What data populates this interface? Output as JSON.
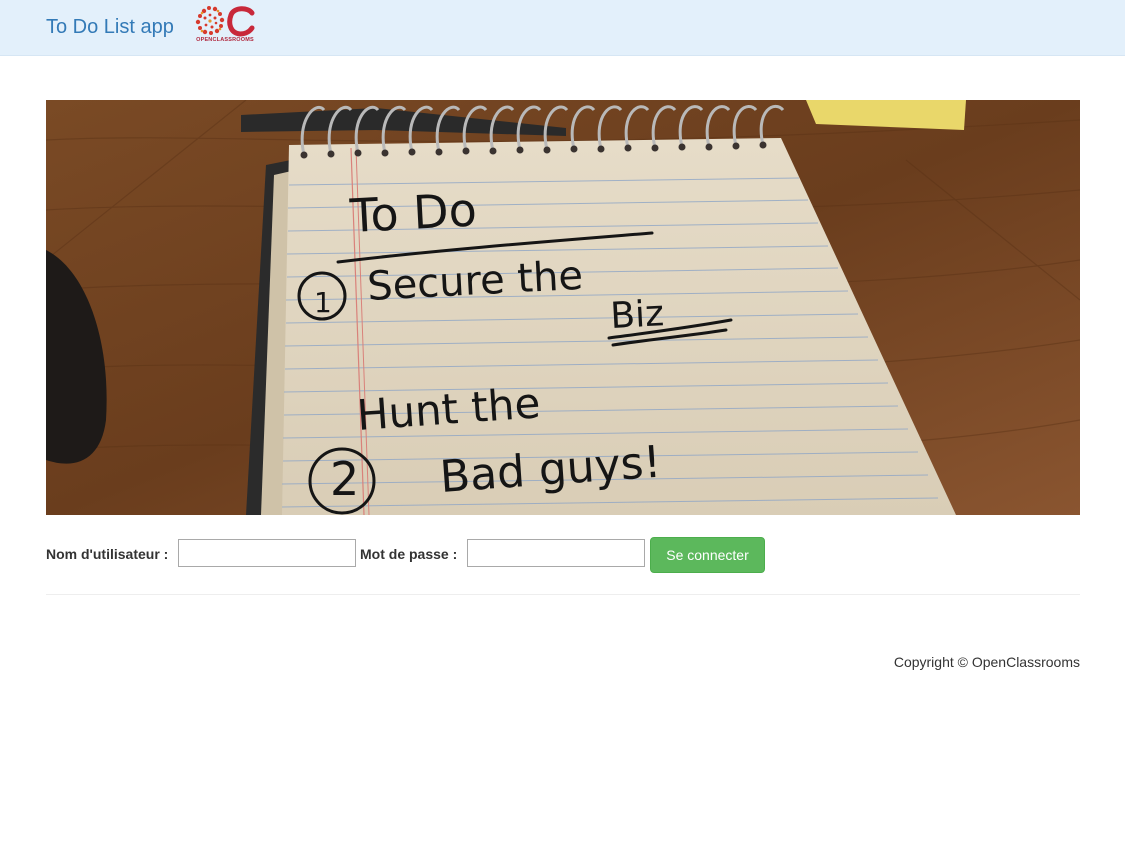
{
  "navbar": {
    "brand": "To Do List app",
    "logo_text": "OPENCLASSROOMS",
    "colors": {
      "background": "#e3f0fb",
      "brand": "#337ab7"
    }
  },
  "hero": {
    "handwriting": {
      "title": "To Do",
      "item1_number": "1",
      "item1_line1": "Secure the",
      "item1_line2": "Biz",
      "item2_line1": "Hunt the",
      "item2_number": "2",
      "item2_line2": "Bad guys!"
    }
  },
  "login": {
    "username_label": "Nom d'utilisateur :",
    "username_value": "",
    "password_label": "Mot de passe :",
    "password_value": "",
    "submit_label": "Se connecter",
    "colors": {
      "submit": "#5cb85c"
    }
  },
  "footer": {
    "copyright": "Copyright © OpenClassrooms"
  }
}
